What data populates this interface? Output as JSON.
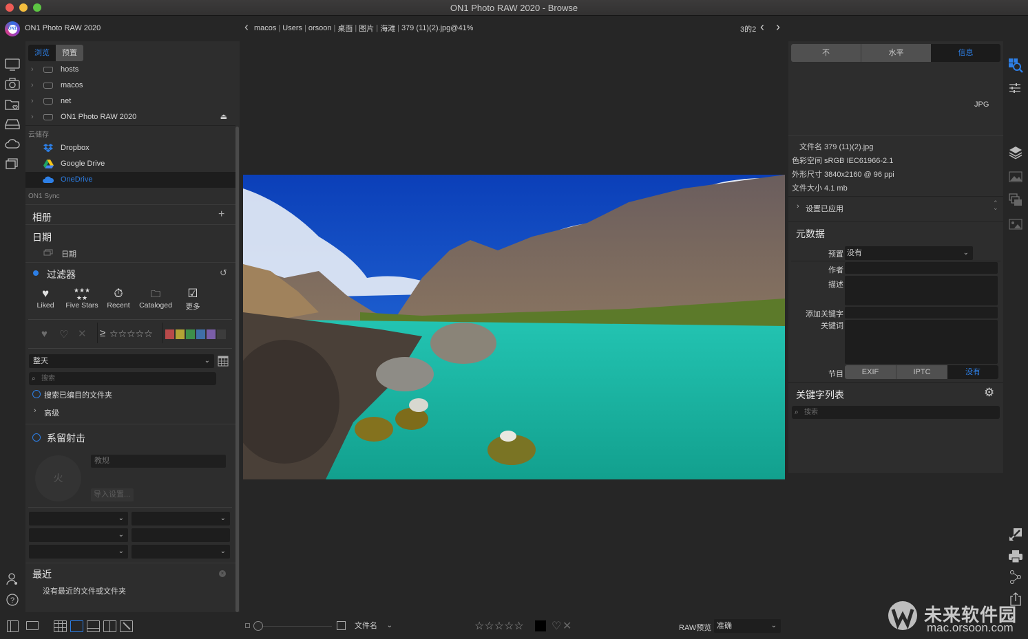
{
  "window": {
    "title": "ON1 Photo RAW 2020 - Browse"
  },
  "app": {
    "name": "ON1 Photo RAW 2020",
    "logo_text": "ON1"
  },
  "breadcrumb": {
    "items": [
      "macos",
      "Users",
      "orsoon",
      "桌面",
      "图片",
      "海滩",
      "379 (11)(2).jpg@41%"
    ]
  },
  "pager": {
    "text": "3的2"
  },
  "left_panel": {
    "tabs": [
      {
        "label": "浏览",
        "active": true
      },
      {
        "label": "预置",
        "active": false
      }
    ],
    "drives": [
      {
        "label": "hosts",
        "eject": false
      },
      {
        "label": "macos",
        "eject": false
      },
      {
        "label": "net",
        "eject": false
      },
      {
        "label": "ON1 Photo RAW 2020",
        "eject": true
      }
    ],
    "cloud_label": "云储存",
    "cloud_items": [
      {
        "label": "Dropbox",
        "icon": "dropbox-icon",
        "selected": false
      },
      {
        "label": "Google Drive",
        "icon": "google-drive-icon",
        "selected": false
      },
      {
        "label": "OneDrive",
        "icon": "onedrive-icon",
        "selected": true
      }
    ],
    "sync_label": "ON1 Sync",
    "albums_label": "相册",
    "dates_label": "日期",
    "dates_item": "日期",
    "filters": {
      "title": "过滤器",
      "buttons": [
        {
          "label": "Liked",
          "icon": "heart-icon"
        },
        {
          "label": "Five Stars",
          "icon": "five-stars-icon"
        },
        {
          "label": "Recent",
          "icon": "stopwatch-icon"
        },
        {
          "label": "Cataloged",
          "icon": "cataloged-folder-icon"
        },
        {
          "label": "更多",
          "icon": "more-checkbox-icon"
        }
      ],
      "rating_prefix": "≥",
      "color_labels": [
        "#b84a4a",
        "#b3a335",
        "#3d8f4a",
        "#3f6fa8",
        "#7a5ea8",
        "#3c3c3c"
      ],
      "time_range": "整天",
      "search_placeholder": "搜索",
      "search_cataloged": "搜索已编目的文件夹",
      "advanced": "高级"
    },
    "tethered": {
      "title": "系留射击",
      "fire_label": "火",
      "preset_placeholder": "教规",
      "import_settings": "导入设置..."
    },
    "recent": {
      "title": "最近",
      "empty": "没有最近的文件或文件夹"
    }
  },
  "right_panel": {
    "tabs": [
      {
        "label": "不",
        "active": false
      },
      {
        "label": "水平",
        "active": false
      },
      {
        "label": "信息",
        "active": true
      }
    ],
    "format": "JPG",
    "info": [
      "文件名 379 (11)(2).jpg",
      "色彩空间 sRGB IEC61966-2.1",
      "外形尺寸 3840x2160 @ 96 ppi",
      "文件大小 4.1 mb"
    ],
    "settings_applied": "设置已应用",
    "metadata": {
      "title": "元数据",
      "preset_label": "预置",
      "preset_value": "没有",
      "author_label": "作者",
      "description_label": "描述",
      "add_keyword_label": "添加关键字",
      "keywords_label": "关键词",
      "section_label": "节目",
      "section_tabs": [
        {
          "label": "EXIF",
          "active": false
        },
        {
          "label": "IPTC",
          "active": false
        },
        {
          "label": "没有",
          "active": true
        }
      ]
    },
    "keyword_list": {
      "title": "关键字列表",
      "search_placeholder": "搜索"
    }
  },
  "bottom_bar": {
    "sort_by": "文件名",
    "raw_preview_label": "RAW预览",
    "raw_preview_value": "准确"
  },
  "watermark": {
    "line1": "未来软件园",
    "line2": "mac.orsoon.com"
  },
  "colors": {
    "accent": "#2d7fe6",
    "panel": "#2d2d2d",
    "background": "#262626"
  }
}
